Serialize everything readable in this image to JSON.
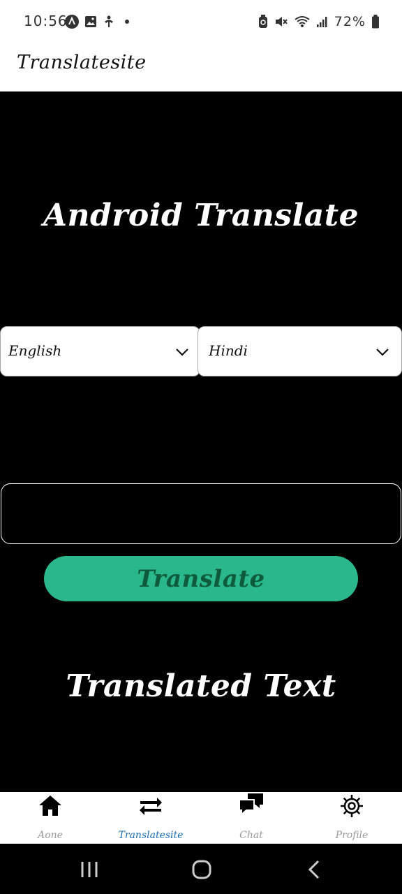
{
  "status": {
    "time": "10:56",
    "battery": "72%"
  },
  "app_bar": {
    "title": "Translatesite"
  },
  "main": {
    "heading": "Android Translate",
    "source_language": "English",
    "target_language": "Hindi",
    "input_value": "",
    "input_placeholder": "",
    "translate_label": "Translate",
    "result_text": "Translated Text"
  },
  "bottom_nav": {
    "items": [
      {
        "label": "Aone",
        "icon": "home-icon",
        "active": false
      },
      {
        "label": "Translatesite",
        "icon": "swap-arrows-icon",
        "active": true
      },
      {
        "label": "Chat",
        "icon": "chat-icon",
        "active": false
      },
      {
        "label": "Profile",
        "icon": "gear-icon",
        "active": false
      }
    ]
  },
  "colors": {
    "accent_button": "#2ab88a",
    "active_tab": "#1b6fb3",
    "background": "#000000"
  }
}
